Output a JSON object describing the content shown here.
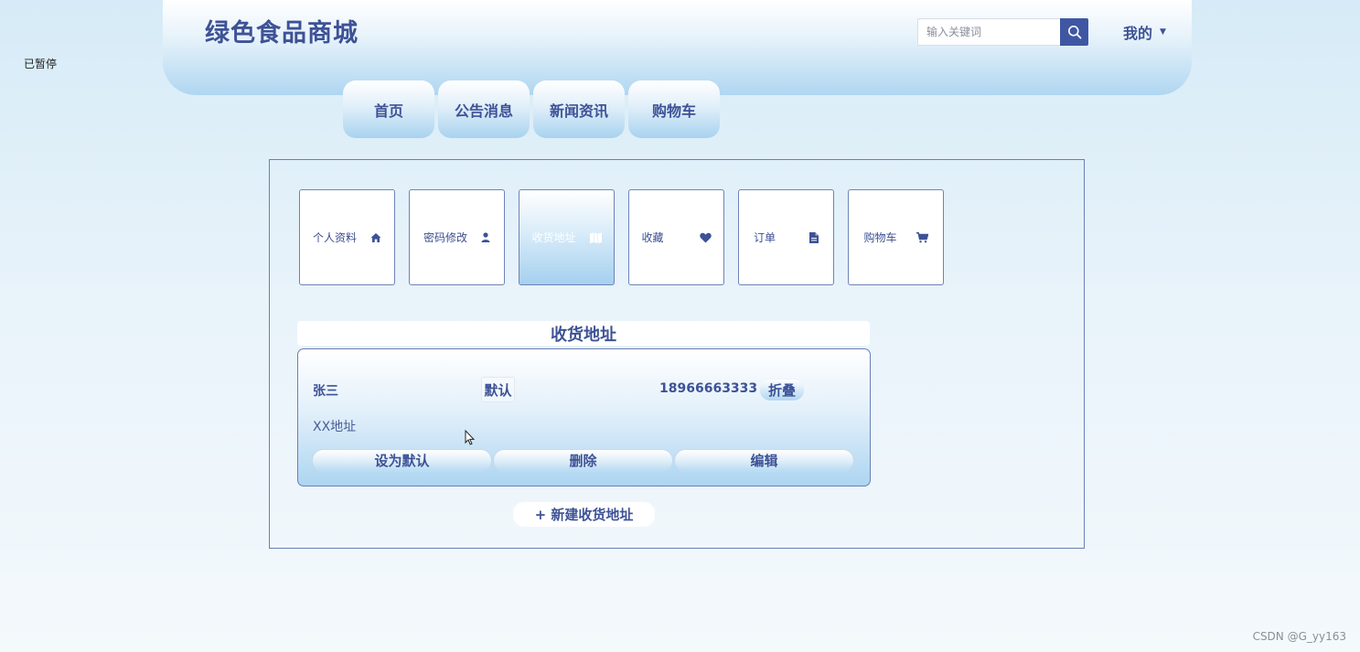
{
  "overlay": {
    "paused_label": "已暂停"
  },
  "header": {
    "site_title": "绿色食品商城",
    "search_placeholder": "输入关键词",
    "user_menu_label": "我的"
  },
  "nav": {
    "tabs": [
      {
        "label": "首页"
      },
      {
        "label": "公告消息"
      },
      {
        "label": "新闻资讯"
      },
      {
        "label": "购物车"
      }
    ]
  },
  "center_menu": {
    "active_index": 2,
    "items": [
      {
        "label": "个人资料",
        "icon": "home-icon"
      },
      {
        "label": "密码修改",
        "icon": "user-icon"
      },
      {
        "label": "收货地址",
        "icon": "map-icon"
      },
      {
        "label": "收藏",
        "icon": "heart-icon"
      },
      {
        "label": "订单",
        "icon": "file-icon"
      },
      {
        "label": "购物车",
        "icon": "cart-icon"
      }
    ]
  },
  "address_section": {
    "title": "收货地址",
    "address": {
      "name": "张三",
      "default_badge": "默认",
      "phone": "18966663333",
      "fold_label": "折叠",
      "detail": "XX地址"
    },
    "actions": {
      "set_default": "设为默认",
      "delete": "删除",
      "edit": "编辑"
    },
    "new_address_label": "+ 新建收货地址"
  },
  "footer": {
    "watermark": "CSDN @G_yy163"
  },
  "colors": {
    "primary": "#3d5296",
    "search_button": "#3f57a3",
    "border": "#6a7fb5"
  }
}
